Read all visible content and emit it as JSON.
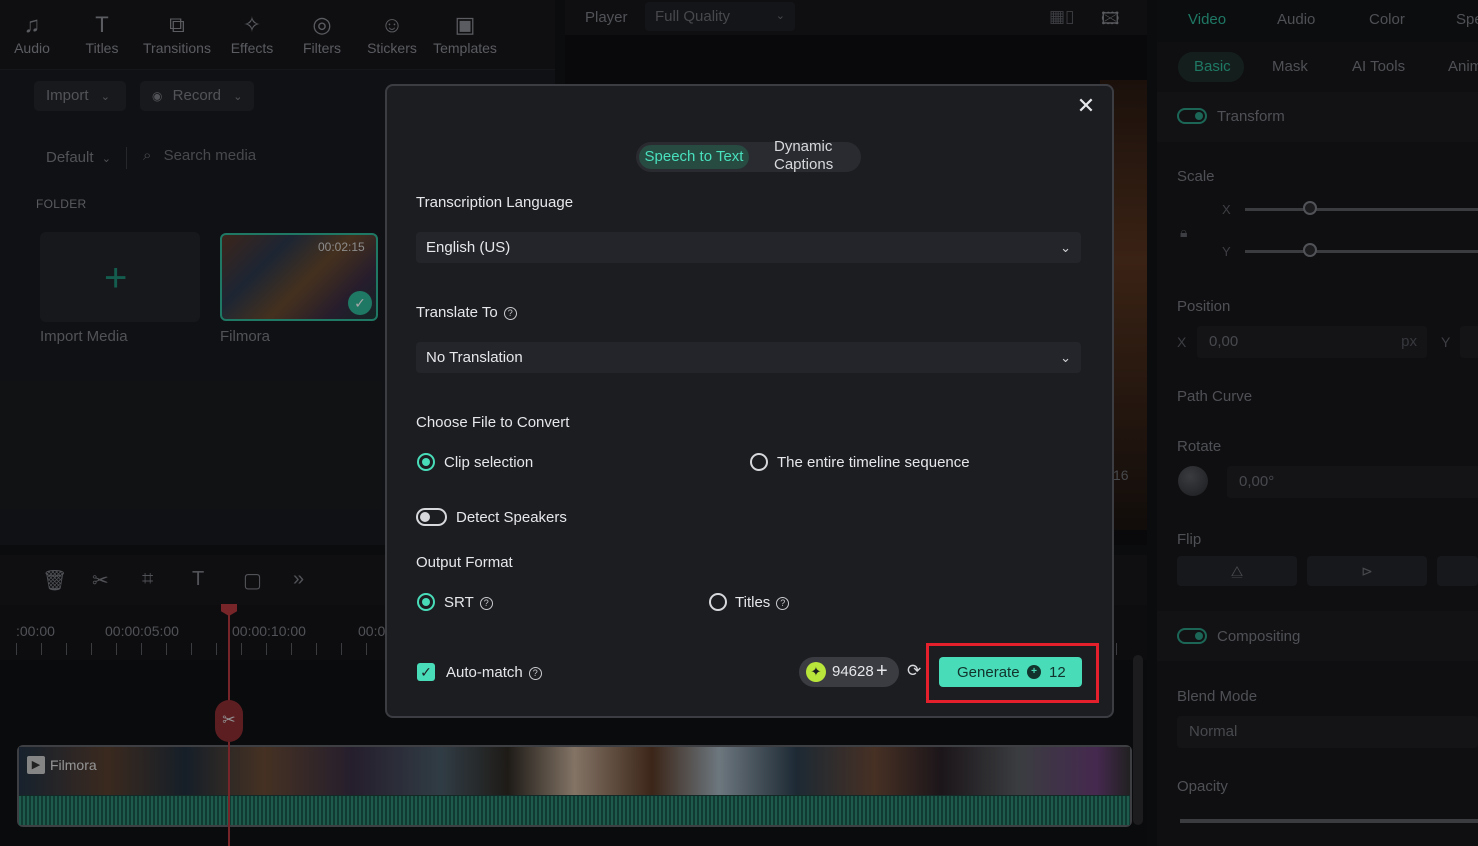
{
  "toolbar": {
    "items": [
      {
        "label": "Audio",
        "icon": "music-note-icon"
      },
      {
        "label": "Titles",
        "icon": "text-t-icon"
      },
      {
        "label": "Transitions",
        "icon": "transition-icon"
      },
      {
        "label": "Effects",
        "icon": "sparkle-icon"
      },
      {
        "label": "Filters",
        "icon": "filter-icon"
      },
      {
        "label": "Stickers",
        "icon": "sticker-icon"
      },
      {
        "label": "Templates",
        "icon": "template-icon"
      }
    ]
  },
  "media": {
    "import_label": "Import",
    "record_label": "Record",
    "sort_label": "Default",
    "search_placeholder": "Search media",
    "folder_label": "FOLDER",
    "import_media_label": "Import Media",
    "clip_name": "Filmora",
    "clip_duration": "00:02:15"
  },
  "player": {
    "label": "Player",
    "quality": "Full Quality",
    "partial_number": "16"
  },
  "properties": {
    "tabs": [
      "Video",
      "Audio",
      "Color",
      "Spe"
    ],
    "subtabs": [
      "Basic",
      "Mask",
      "AI Tools",
      "Anim"
    ],
    "transform_label": "Transform",
    "scale_label": "Scale",
    "x_axis": "X",
    "y_axis": "Y",
    "position_label": "Position",
    "position_x_value": "0,00",
    "position_unit": "px",
    "path_curve_label": "Path Curve",
    "rotate_label": "Rotate",
    "rotate_value": "0,00°",
    "flip_label": "Flip",
    "compositing_label": "Compositing",
    "blend_mode_label": "Blend Mode",
    "blend_mode_value": "Normal",
    "opacity_label": "Opacity"
  },
  "timeline": {
    "ticks": [
      ":00:00",
      "00:00:05:00",
      "00:00:10:00",
      "00:0"
    ],
    "clip_label": "Filmora"
  },
  "dialog": {
    "mode_tabs": {
      "active": "Speech to Text",
      "inactive": "Dynamic Captions"
    },
    "transcription_language_label": "Transcription Language",
    "transcription_language_value": "English (US)",
    "translate_to_label": "Translate To",
    "translate_to_value": "No Translation",
    "choose_file_label": "Choose File to Convert",
    "file_options": {
      "clip_selection": "Clip selection",
      "entire_timeline": "The entire timeline sequence",
      "selected": "clip_selection"
    },
    "detect_speakers_label": "Detect Speakers",
    "detect_speakers_on": false,
    "output_format_label": "Output Format",
    "output_options": {
      "srt": "SRT",
      "titles": "Titles",
      "selected": "srt"
    },
    "auto_match_label": "Auto-match",
    "auto_match_checked": true,
    "credits_balance": "94628",
    "generate_label": "Generate",
    "generate_cost": "12"
  },
  "colors": {
    "accent": "#48dcb9",
    "highlight_box": "#e3202b"
  }
}
